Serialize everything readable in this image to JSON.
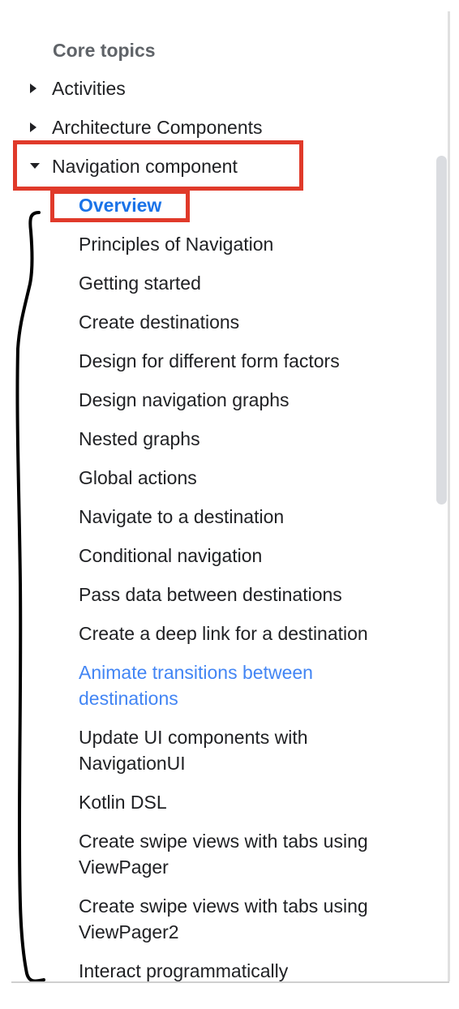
{
  "sidebar": {
    "heading": "Core topics",
    "top_items": [
      {
        "label": "Activities",
        "expanded": false,
        "caret_icon": "triangle-right"
      },
      {
        "label": "Architecture Components",
        "expanded": false,
        "caret_icon": "triangle-right"
      },
      {
        "label": "Navigation component",
        "expanded": true,
        "caret_icon": "triangle-down"
      }
    ],
    "sub_items": [
      {
        "label": "Overview",
        "state": "selected"
      },
      {
        "label": "Principles of Navigation"
      },
      {
        "label": "Getting started"
      },
      {
        "label": "Create destinations"
      },
      {
        "label": "Design for different form factors"
      },
      {
        "label": "Design navigation graphs"
      },
      {
        "label": "Nested graphs"
      },
      {
        "label": "Global actions"
      },
      {
        "label": "Navigate to a destination"
      },
      {
        "label": "Conditional navigation"
      },
      {
        "label": "Pass data between destinations"
      },
      {
        "label": "Create a deep link for a destination"
      },
      {
        "label": "Animate transitions between",
        "label2": "destinations",
        "state": "link"
      },
      {
        "label": "Update UI components with",
        "label2": "NavigationUI"
      },
      {
        "label": "Kotlin DSL"
      },
      {
        "label": "Create swipe views with tabs using",
        "label2": "ViewPager"
      },
      {
        "label": "Create swipe views with tabs using",
        "label2": "ViewPager2"
      },
      {
        "label": "Interact programmatically"
      }
    ]
  },
  "colors": {
    "selected": "#1a73e8",
    "link": "#4285f4",
    "annotation_box": "#e03a2a",
    "annotation_bracket": "#000000",
    "text": "#202124",
    "heading": "#5f6368"
  }
}
